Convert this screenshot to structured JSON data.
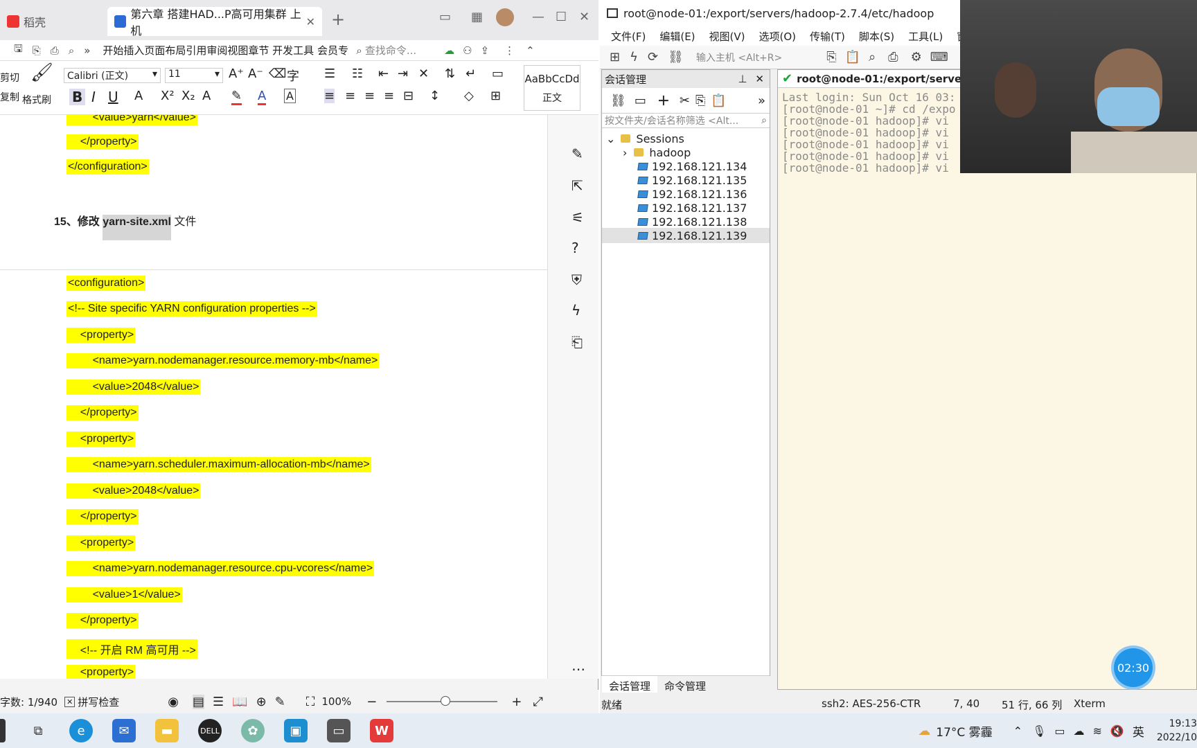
{
  "wps": {
    "tabs": [
      "稻壳",
      "第六章 搭建HAD...P高可用集群 上机"
    ],
    "ribbon_tabs": "开始插入页面布局引用审阅视图章节 开发工具 会员专",
    "search_placeholder": "查找命令...",
    "clipboard": {
      "cut": "剪切",
      "copy": "复制",
      "format_painter": "格式刷"
    },
    "font_name": "Calibri (正文)",
    "font_size": "11",
    "style_preview": "AaBbCcDd",
    "style_name": "正文",
    "document_lines": [
      "        <value>yarn</value>",
      "    </property>",
      "</configuration>",
      "<configuration>",
      "<!-- Site specific YARN configuration properties -->",
      "    <property>",
      "        <name>yarn.nodemanager.resource.memory-mb</name>",
      "        <value>2048</value>",
      "    </property>",
      "    <property>",
      "        <name>yarn.scheduler.maximum-allocation-mb</name>",
      "        <value>2048</value>",
      "    </property>",
      "    <property>",
      "        <name>yarn.nodemanager.resource.cpu-vcores</name>",
      "        <value>1</value>",
      "    </property>",
      "    <!-- 开启 RM 高可用 -->",
      "    <property>"
    ],
    "heading": {
      "prefix": "15、修改 ",
      "file": "yarn-site.xml",
      "suffix": " 文件"
    },
    "status": {
      "word_count": "字数: 1/940",
      "spell_check": "拼写检查",
      "zoom": "100%"
    }
  },
  "xshell": {
    "title": "root@node-01:/export/servers/hadoop-2.7.4/etc/hadoop",
    "menu": [
      "文件(F)",
      "编辑(E)",
      "视图(V)",
      "选项(O)",
      "传输(T)",
      "脚本(S)",
      "工具(L)",
      "窗"
    ],
    "host_placeholder": "输入主机 <Alt+R>",
    "session_panel_title": "会话管理",
    "session_filter_placeholder": "按文件夹/会话名称筛选 <Alt...",
    "tree": {
      "root": "Sessions",
      "folder": "hadoop",
      "hosts": [
        "192.168.121.134",
        "192.168.121.135",
        "192.168.121.136",
        "192.168.121.137",
        "192.168.121.138",
        "192.168.121.139"
      ],
      "selected": "192.168.121.139"
    },
    "bottom_tabs": [
      "会话管理",
      "命令管理"
    ],
    "terminal_tab": "root@node-01:/export/servers/",
    "terminal_lines": [
      "Last login: Sun Oct 16 03:",
      "[root@node-01 ~]# cd /expo",
      "[root@node-01 hadoop]# vi",
      "[root@node-01 hadoop]# vi",
      "[root@node-01 hadoop]# vi",
      "[root@node-01 hadoop]# vi",
      "[root@node-01 hadoop]# vi"
    ],
    "status": {
      "ready": "就绪",
      "protocol": "ssh2: AES-256-CTR",
      "cursor": "7, 40",
      "size": "51 行, 66 列",
      "term": "Xterm"
    }
  },
  "timer": "02:30",
  "taskbar": {
    "weather": "17°C 雾霾",
    "ime": "英",
    "time": "19:13",
    "date": "2022/10"
  }
}
